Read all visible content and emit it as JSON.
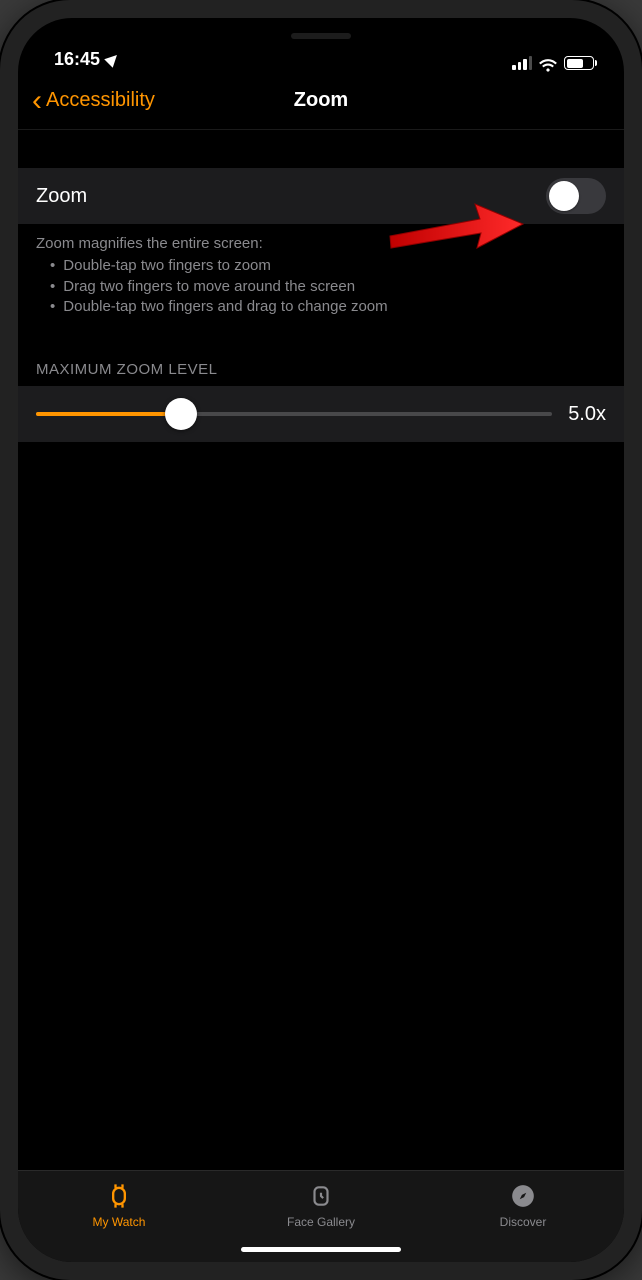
{
  "status": {
    "time": "16:45",
    "location_arrow": true,
    "signal_bars": 3,
    "wifi": true,
    "battery_pct": 60
  },
  "nav": {
    "back_label": "Accessibility",
    "title": "Zoom"
  },
  "zoom_row": {
    "label": "Zoom",
    "enabled": false
  },
  "zoom_description": {
    "intro": "Zoom magnifies the entire screen:",
    "bullets": [
      "Double-tap two fingers to zoom",
      "Drag two fingers to move around the screen",
      "Double-tap two fingers and drag to change zoom"
    ]
  },
  "slider": {
    "header": "MAXIMUM ZOOM LEVEL",
    "value_label": "5.0x",
    "fill_pct": 28
  },
  "tabs": [
    {
      "id": "my-watch",
      "label": "My Watch",
      "active": true
    },
    {
      "id": "face-gallery",
      "label": "Face Gallery",
      "active": false
    },
    {
      "id": "discover",
      "label": "Discover",
      "active": false
    }
  ],
  "annotation": {
    "type": "red-arrow",
    "points_to": "zoom-toggle"
  },
  "colors": {
    "accent": "#ff9500",
    "row_bg": "#1c1c1e",
    "secondary_text": "#8a8a8e"
  }
}
